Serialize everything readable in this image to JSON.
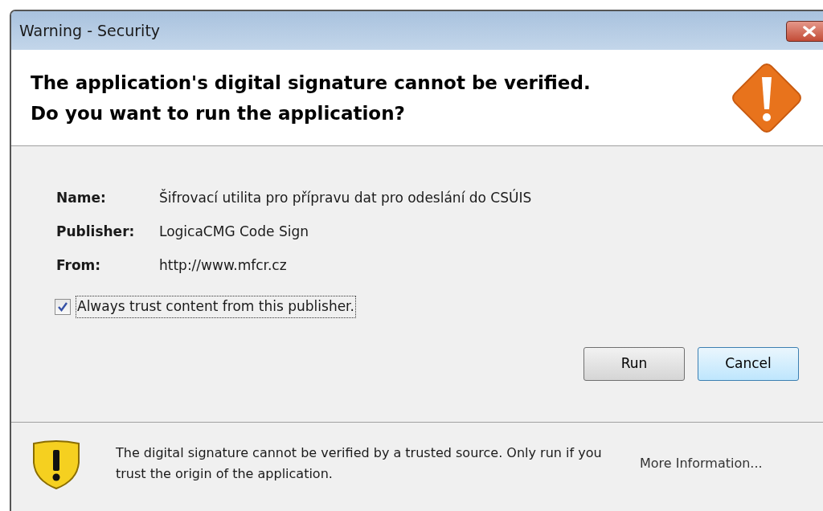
{
  "window": {
    "title": "Warning - Security"
  },
  "header": {
    "lines": [
      "The application's digital signature cannot be verified.",
      "Do you want to run the application?"
    ]
  },
  "details": [
    {
      "label": "Name:",
      "value": "Šifrovací utilita pro přípravu dat pro odeslání do CSÚIS"
    },
    {
      "label": "Publisher:",
      "value": "LogicaCMG Code Sign"
    },
    {
      "label": "From:",
      "value": "http://www.mfcr.cz"
    }
  ],
  "trust_checkbox": {
    "label": "Always trust content from this publisher.",
    "checked": true
  },
  "buttons": [
    {
      "label": "Run",
      "selected": false
    },
    {
      "label": "Cancel",
      "selected": true
    }
  ],
  "footer": {
    "message": "The digital signature cannot be verified by a trusted source.  Only run if you trust the origin of the application.",
    "link": "More Information..."
  }
}
